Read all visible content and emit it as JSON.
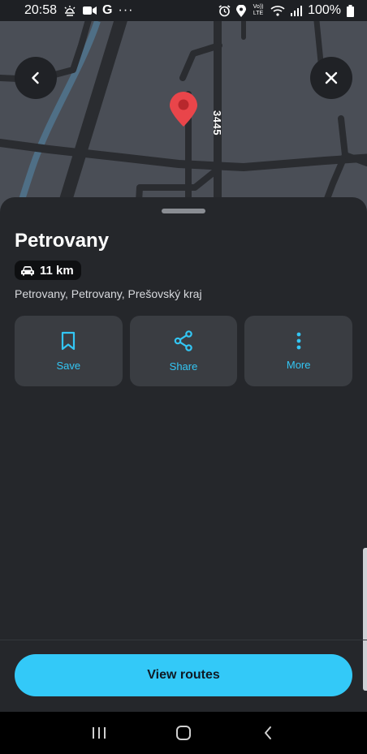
{
  "status_bar": {
    "time": "20:58",
    "left_icons": [
      "weather-icon",
      "video-call-icon",
      "google-icon",
      "more-dots-icon"
    ],
    "google_label": "G",
    "dots_label": "···",
    "right_icons": [
      "alarm-icon",
      "location-icon",
      "volte-icon",
      "wifi-icon",
      "signal-icon",
      "battery-icon"
    ],
    "volte_label": "Vo)) LTE",
    "battery": "100%"
  },
  "map": {
    "road_label": "3445",
    "marker_color": "#e9454a"
  },
  "place": {
    "title": "Petrovany",
    "distance": "11 km",
    "address": "Petrovany, Petrovany, Prešovský kraj"
  },
  "actions": [
    {
      "label": "Save",
      "icon": "bookmark-icon"
    },
    {
      "label": "Share",
      "icon": "share-icon"
    },
    {
      "label": "More",
      "icon": "more-vertical-icon"
    }
  ],
  "cta": {
    "label": "View routes"
  },
  "colors": {
    "accent": "#33c9f8",
    "sheet": "#25272b",
    "tile": "#3a3d42",
    "map": "#4a4e56"
  },
  "nav_bar": [
    "recent-apps-icon",
    "home-icon",
    "back-icon"
  ]
}
